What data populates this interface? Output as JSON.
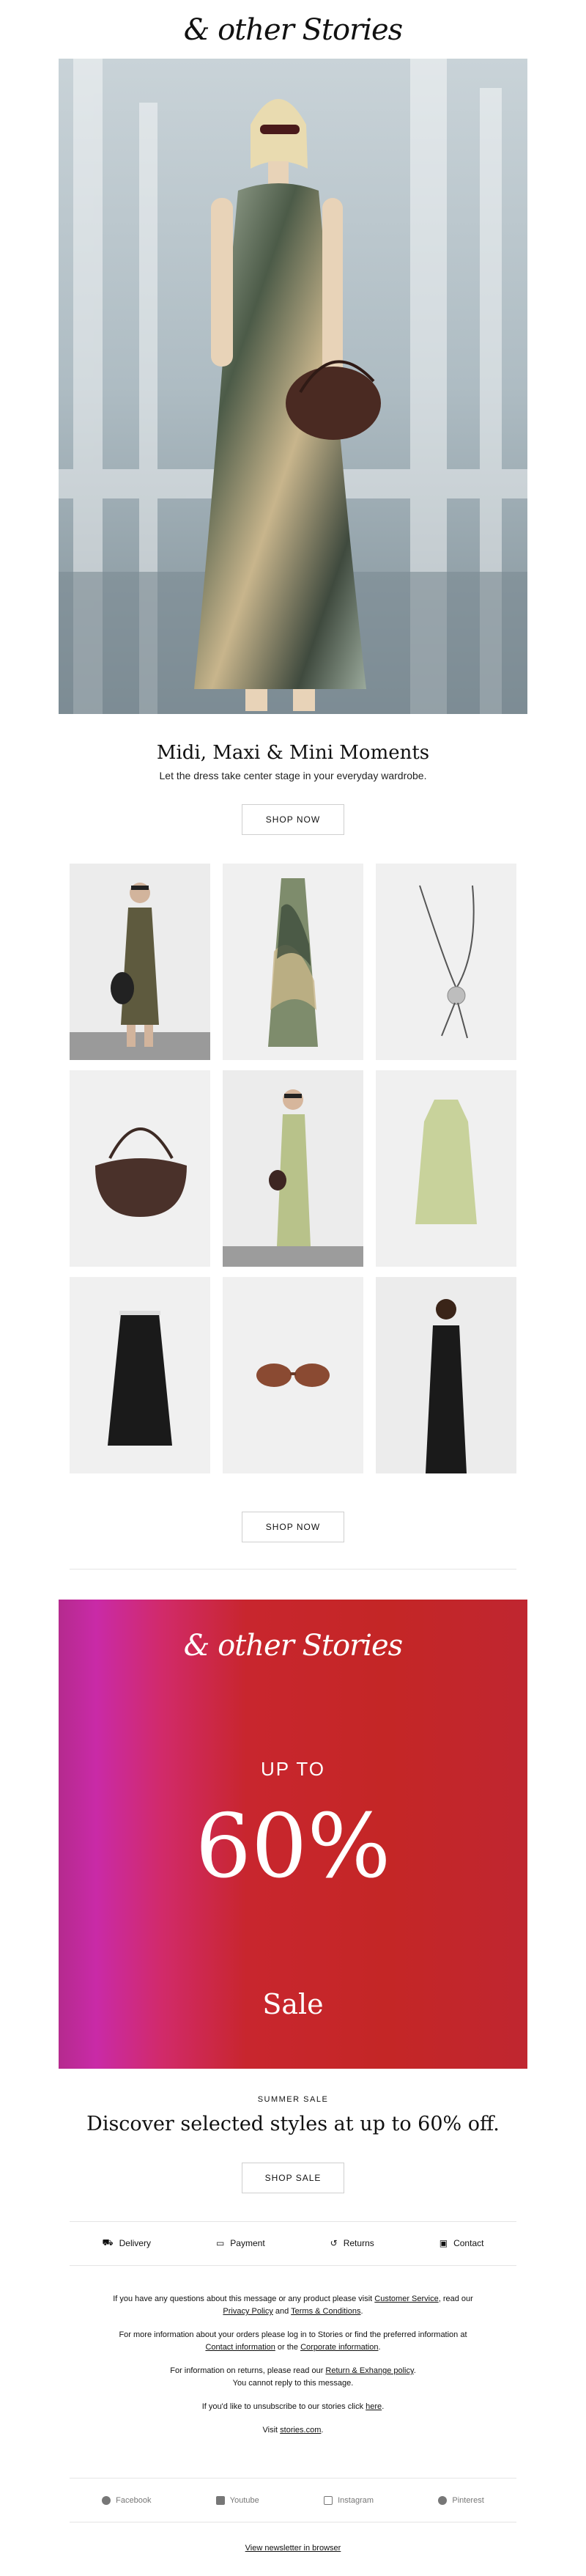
{
  "brand": {
    "logo": "& other Stories"
  },
  "hero": {
    "title": "Midi, Maxi & Mini Moments",
    "subtitle": "Let the dress take center stage in your everyday wardrobe.",
    "cta": "SHOP NOW"
  },
  "products": [
    {
      "name": "olive-dress-model"
    },
    {
      "name": "printed-dress"
    },
    {
      "name": "necklace"
    },
    {
      "name": "brown-bag"
    },
    {
      "name": "green-dress-model"
    },
    {
      "name": "green-mini-dress"
    },
    {
      "name": "black-slip-dress"
    },
    {
      "name": "sunglasses"
    },
    {
      "name": "black-dress-model"
    }
  ],
  "grid_cta": "SHOP NOW",
  "sale_banner": {
    "logo": "& other Stories",
    "up_to": "UP TO",
    "percent": "60%",
    "word": "Sale"
  },
  "sale_section": {
    "eyebrow": "SUMMER SALE",
    "headline": "Discover selected styles at up to 60% off.",
    "cta": "SHOP SALE"
  },
  "services": [
    {
      "icon": "delivery-icon",
      "label": "Delivery"
    },
    {
      "icon": "payment-icon",
      "label": "Payment"
    },
    {
      "icon": "returns-icon",
      "label": "Returns"
    },
    {
      "icon": "contact-icon",
      "label": "Contact"
    }
  ],
  "legal": {
    "p1_a": "If you have any questions about this message or any product please visit ",
    "p1_link1": "Customer Service",
    "p1_b": ", read our ",
    "p1_link2": "Privacy Policy",
    "p1_c": " and ",
    "p1_link3": "Terms & Conditions",
    "p1_d": ".",
    "p2_a": "For more information about your orders please log in to Stories or find the preferred information at ",
    "p2_link1": "Contact information",
    "p2_b": " or the ",
    "p2_link2": "Corporate information",
    "p2_c": ".",
    "p3_a": "For information on returns, please read our ",
    "p3_link": "Return & Exhange policy",
    "p3_b": ".",
    "p3_line2": "You cannot reply to this message.",
    "p4_a": "If you'd like to unsubscribe to our stories click ",
    "p4_link": "here",
    "p4_b": ".",
    "p5_a": "Visit ",
    "p5_link": "stories.com",
    "p5_b": "."
  },
  "social": [
    {
      "icon": "facebook-icon",
      "label": "Facebook"
    },
    {
      "icon": "youtube-icon",
      "label": "Youtube"
    },
    {
      "icon": "instagram-icon",
      "label": "Instagram"
    },
    {
      "icon": "pinterest-icon",
      "label": "Pinterest"
    }
  ],
  "footer": {
    "webview": "View newsletter in browser"
  }
}
